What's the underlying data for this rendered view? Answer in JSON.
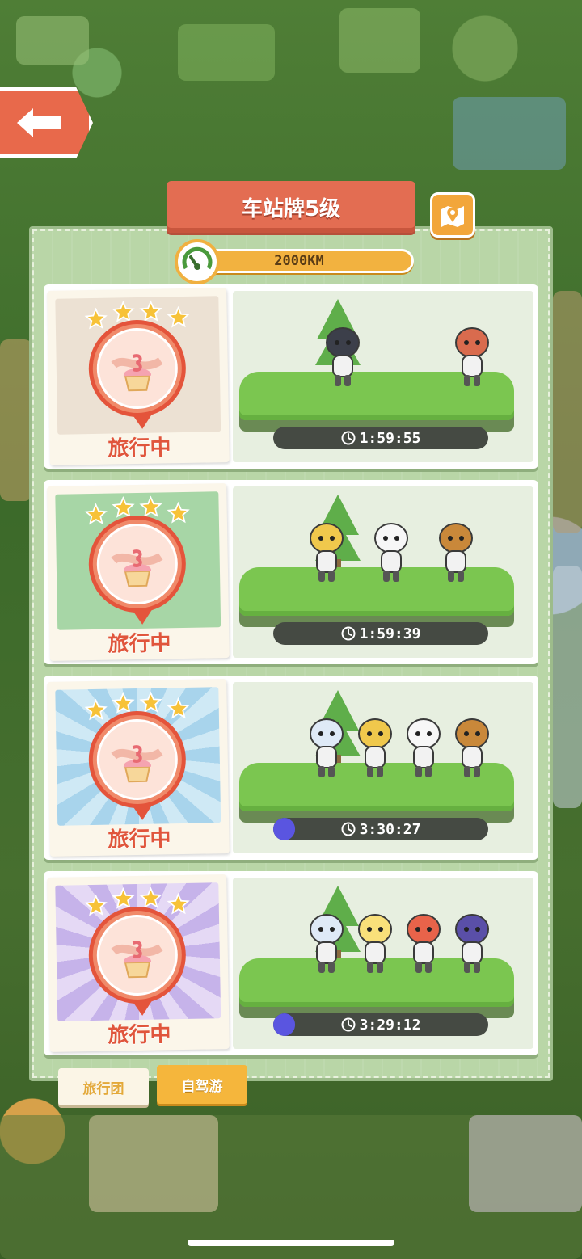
{
  "header": {
    "title": "车站牌5级",
    "distance": "2000KM"
  },
  "trips": [
    {
      "status": "旅行中",
      "stars": 4,
      "timer": "1:59:55",
      "progress": 0.0,
      "theme": "beige"
    },
    {
      "status": "旅行中",
      "stars": 4,
      "timer": "1:59:39",
      "progress": 0.0,
      "theme": "green"
    },
    {
      "status": "旅行中",
      "stars": 4,
      "timer": "3:30:27",
      "progress": 0.1,
      "theme": "blue"
    },
    {
      "status": "旅行中",
      "stars": 4,
      "timer": "3:29:12",
      "progress": 0.1,
      "theme": "purple"
    }
  ],
  "tabs": [
    {
      "label": "旅行团",
      "active": false
    },
    {
      "label": "自驾游",
      "active": true
    }
  ],
  "colors": {
    "accent": "#e36d52",
    "gold": "#f2b240",
    "panel": "#b9d6a7",
    "progress": "#5a55e0"
  }
}
